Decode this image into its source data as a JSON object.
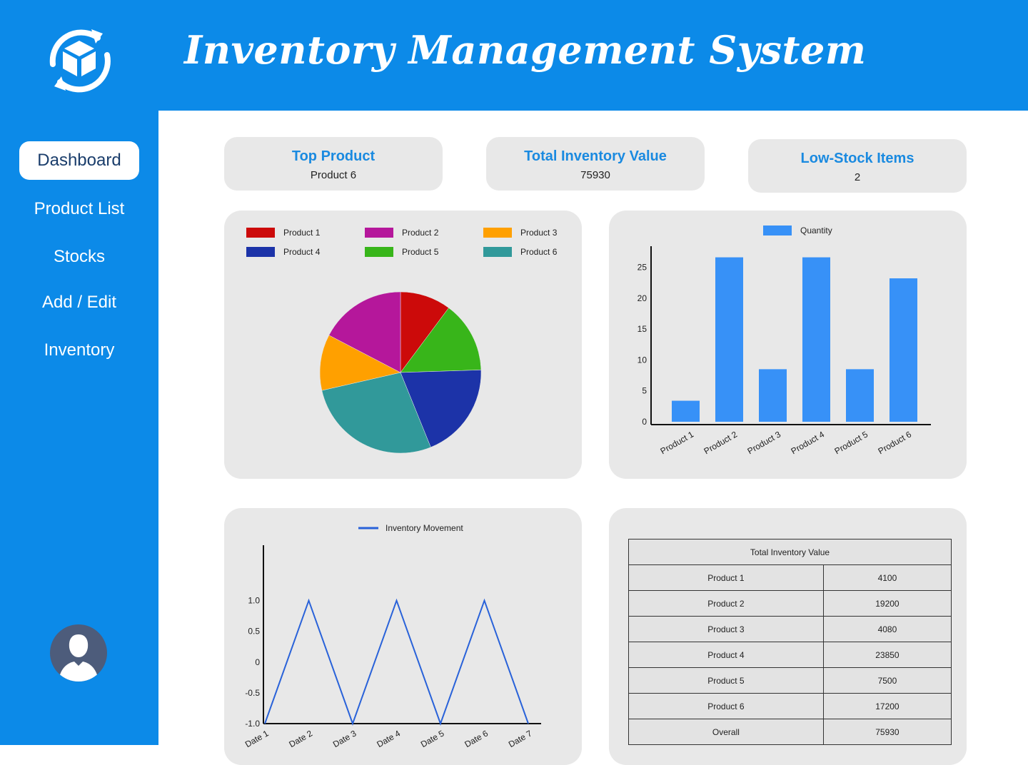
{
  "header": {
    "title": "Inventory Management System"
  },
  "sidebar": {
    "items": [
      {
        "label": "Dashboard"
      },
      {
        "label": "Product List"
      },
      {
        "label": "Stocks"
      },
      {
        "label": "Add / Edit"
      },
      {
        "label": "Inventory"
      }
    ]
  },
  "stats": [
    {
      "title": "Top Product",
      "value": "Product 6"
    },
    {
      "title": "Total Inventory Value",
      "value": "75930"
    },
    {
      "title": "Low-Stock Items",
      "value": "2"
    }
  ],
  "chart_data": [
    {
      "type": "pie",
      "categories": [
        "Product 1",
        "Product 2",
        "Product 3",
        "Product 4",
        "Product 5",
        "Product 6"
      ],
      "values": [
        10,
        17,
        11,
        19,
        14,
        27
      ],
      "colors": [
        "#cc0a0a",
        "#b5179b",
        "#ffa000",
        "#1c33a8",
        "#38b51a",
        "#31999a"
      ],
      "legend": "top"
    },
    {
      "type": "bar",
      "categories": [
        "Product 1",
        "Product 2",
        "Product 3",
        "Product 4",
        "Product 5",
        "Product 6"
      ],
      "series": [
        {
          "name": "Quantity",
          "values": [
            3.4,
            26.6,
            8.5,
            26.6,
            8.5,
            23.2
          ],
          "color": "#3791f7"
        }
      ],
      "yticks": [
        0,
        5,
        10,
        15,
        20,
        25
      ],
      "ylim": [
        0,
        28.4
      ],
      "legend": "top"
    },
    {
      "type": "line",
      "x": [
        "Date 1",
        "Date 2",
        "Date 3",
        "Date 4",
        "Date 5",
        "Date 6",
        "Date 7"
      ],
      "series": [
        {
          "name": "Inventory Movement",
          "values": [
            -1.0,
            1.0,
            -1.0,
            1.0,
            -1.0,
            1.0,
            -1.0
          ],
          "color": "#2962d9"
        }
      ],
      "yticks": [
        "-1.0",
        "-0.5",
        "0",
        "0.5",
        "1.0"
      ],
      "ylim": [
        -1.0,
        1.9
      ],
      "legend": "top"
    },
    {
      "type": "table",
      "title": "Total Inventory Value",
      "rows": [
        {
          "label": "Product 1",
          "value": "4100"
        },
        {
          "label": "Product 2",
          "value": "19200"
        },
        {
          "label": "Product 3",
          "value": "4080"
        },
        {
          "label": "Product 4",
          "value": "23850"
        },
        {
          "label": "Product 5",
          "value": "7500"
        },
        {
          "label": "Product 6",
          "value": "17200"
        },
        {
          "label": "Overall",
          "value": "75930"
        }
      ]
    }
  ]
}
